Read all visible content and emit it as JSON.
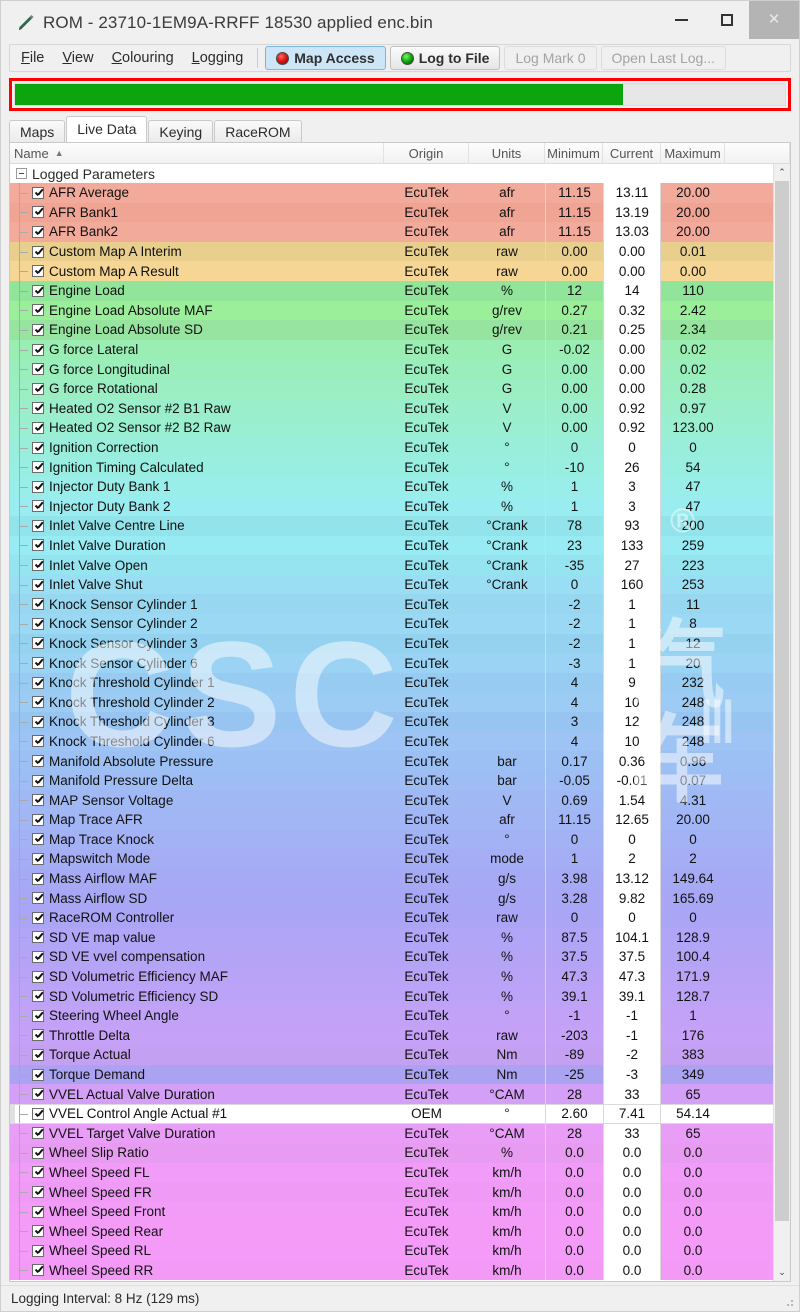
{
  "window": {
    "title": "ROM - 23710-1EM9A-RRFF 18530 applied enc.bin",
    "icon": "pen-icon",
    "minimize_label": "–",
    "maximize_label": "❐",
    "close_label": "×"
  },
  "menu": [
    {
      "label": "File",
      "accel": "F"
    },
    {
      "label": "View",
      "accel": "V"
    },
    {
      "label": "Colouring",
      "accel": "C"
    },
    {
      "label": "Logging",
      "accel": "L"
    }
  ],
  "toolbar": {
    "map_access": {
      "label": "Map Access",
      "icon": "red-led-icon",
      "state": "active",
      "led_color": "#e01515"
    },
    "log_to_file": {
      "label": "Log to File",
      "icon": "green-led-icon",
      "state": "enabled",
      "led_color": "#16b311"
    },
    "log_mark": {
      "label": "Log Mark 0",
      "state": "disabled"
    },
    "open_last_log": {
      "label": "Open Last Log...",
      "state": "disabled"
    }
  },
  "progress": {
    "percent": 79,
    "fill_color": "#0da50d",
    "border_color": "#fe0000"
  },
  "tabs": [
    {
      "label": "Maps",
      "selected": false
    },
    {
      "label": "Live Data",
      "selected": true
    },
    {
      "label": "Keying",
      "selected": false
    },
    {
      "label": "RaceROM",
      "selected": false
    }
  ],
  "grid": {
    "columns": [
      {
        "key": "name",
        "label": "Name",
        "sorted": "asc",
        "sort_glyph": "▲"
      },
      {
        "key": "origin",
        "label": "Origin"
      },
      {
        "key": "units",
        "label": "Units"
      },
      {
        "key": "minimum",
        "label": "Minimum"
      },
      {
        "key": "current",
        "label": "Current"
      },
      {
        "key": "maximum",
        "label": "Maximum"
      }
    ],
    "group_label": "Logged Parameters",
    "group_expanded": true,
    "scroll_up_glyph": "⌃",
    "scroll_down_glyph": "⌄",
    "rows": [
      {
        "checked": true,
        "name": "AFR Average",
        "origin": "EcuTek",
        "units": "afr",
        "minimum": "11.15",
        "current": "13.11",
        "maximum": "20.00",
        "bg": "#f2aa9b"
      },
      {
        "checked": true,
        "name": "AFR Bank1",
        "origin": "EcuTek",
        "units": "afr",
        "minimum": "11.15",
        "current": "13.19",
        "maximum": "20.00",
        "bg": "#efa494"
      },
      {
        "checked": true,
        "name": "AFR Bank2",
        "origin": "EcuTek",
        "units": "afr",
        "minimum": "11.15",
        "current": "13.03",
        "maximum": "20.00",
        "bg": "#f2aa9b"
      },
      {
        "checked": true,
        "name": "Custom Map A Interim",
        "origin": "EcuTek",
        "units": "raw",
        "minimum": "0.00",
        "current": "0.00",
        "maximum": "0.01",
        "bg": "#e8cf8e"
      },
      {
        "checked": true,
        "name": "Custom Map A Result",
        "origin": "EcuTek",
        "units": "raw",
        "minimum": "0.00",
        "current": "0.00",
        "maximum": "0.00",
        "bg": "#f6d694"
      },
      {
        "checked": true,
        "name": "Engine Load",
        "origin": "EcuTek",
        "units": "%",
        "minimum": "12",
        "current": "14",
        "maximum": "110",
        "bg": "#90e59a"
      },
      {
        "checked": true,
        "name": "Engine Load Absolute MAF",
        "origin": "EcuTek",
        "units": "g/rev",
        "minimum": "0.27",
        "current": "0.32",
        "maximum": "2.42",
        "bg": "#9bef9b"
      },
      {
        "checked": true,
        "name": "Engine Load Absolute SD",
        "origin": "EcuTek",
        "units": "g/rev",
        "minimum": "0.21",
        "current": "0.25",
        "maximum": "2.34",
        "bg": "#97e4a0"
      },
      {
        "checked": true,
        "name": "G force Lateral",
        "origin": "EcuTek",
        "units": "G",
        "minimum": "-0.02",
        "current": "0.00",
        "maximum": "0.02",
        "bg": "#9aeeb4"
      },
      {
        "checked": true,
        "name": "G force Longitudinal",
        "origin": "EcuTek",
        "units": "G",
        "minimum": "0.00",
        "current": "0.00",
        "maximum": "0.02",
        "bg": "#9aeebb"
      },
      {
        "checked": true,
        "name": "G force Rotational",
        "origin": "EcuTek",
        "units": "G",
        "minimum": "0.00",
        "current": "0.00",
        "maximum": "0.28",
        "bg": "#9aeec2"
      },
      {
        "checked": true,
        "name": "Heated O2 Sensor #2 B1 Raw",
        "origin": "EcuTek",
        "units": "V",
        "minimum": "0.00",
        "current": "0.92",
        "maximum": "0.97",
        "bg": "#9aeeca"
      },
      {
        "checked": true,
        "name": "Heated O2 Sensor #2 B2 Raw",
        "origin": "EcuTek",
        "units": "V",
        "minimum": "0.00",
        "current": "0.92",
        "maximum": "123.00",
        "bg": "#9aefd2"
      },
      {
        "checked": true,
        "name": "Ignition Correction",
        "origin": "EcuTek",
        "units": "°",
        "minimum": "0",
        "current": "0",
        "maximum": "0",
        "bg": "#99eedb"
      },
      {
        "checked": true,
        "name": "Ignition Timing Calculated",
        "origin": "EcuTek",
        "units": "°",
        "minimum": "-10",
        "current": "26",
        "maximum": "54",
        "bg": "#99eee2"
      },
      {
        "checked": true,
        "name": "Injector Duty Bank 1",
        "origin": "EcuTek",
        "units": "%",
        "minimum": "1",
        "current": "3",
        "maximum": "47",
        "bg": "#99eeea"
      },
      {
        "checked": true,
        "name": "Injector Duty Bank 2",
        "origin": "EcuTek",
        "units": "%",
        "minimum": "1",
        "current": "3",
        "maximum": "47",
        "bg": "#99ecef"
      },
      {
        "checked": true,
        "name": "Inlet Valve Centre Line",
        "origin": "EcuTek",
        "units": "°Crank",
        "minimum": "78",
        "current": "93",
        "maximum": "200",
        "bg": "#93e4ea"
      },
      {
        "checked": true,
        "name": "Inlet Valve Duration",
        "origin": "EcuTek",
        "units": "°Crank",
        "minimum": "23",
        "current": "133",
        "maximum": "259",
        "bg": "#99ebf3"
      },
      {
        "checked": true,
        "name": "Inlet Valve Open",
        "origin": "EcuTek",
        "units": "°Crank",
        "minimum": "-35",
        "current": "27",
        "maximum": "223",
        "bg": "#96e4ef"
      },
      {
        "checked": true,
        "name": "Inlet Valve Shut",
        "origin": "EcuTek",
        "units": "°Crank",
        "minimum": "0",
        "current": "160",
        "maximum": "253",
        "bg": "#9adef3"
      },
      {
        "checked": true,
        "name": "Knock Sensor Cylinder 1",
        "origin": "EcuTek",
        "units": "",
        "minimum": "-2",
        "current": "1",
        "maximum": "11",
        "bg": "#97d7f0"
      },
      {
        "checked": true,
        "name": "Knock Sensor Cylinder 2",
        "origin": "EcuTek",
        "units": "",
        "minimum": "-2",
        "current": "1",
        "maximum": "8",
        "bg": "#9ad8f3"
      },
      {
        "checked": true,
        "name": "Knock Sensor Cylinder 3",
        "origin": "EcuTek",
        "units": "",
        "minimum": "-2",
        "current": "1",
        "maximum": "12",
        "bg": "#95d2f0"
      },
      {
        "checked": true,
        "name": "Knock Sensor Cylinder 6",
        "origin": "EcuTek",
        "units": "",
        "minimum": "-3",
        "current": "1",
        "maximum": "20",
        "bg": "#9bd3f4"
      },
      {
        "checked": true,
        "name": "Knock Threshold Cylinder 1",
        "origin": "EcuTek",
        "units": "",
        "minimum": "4",
        "current": "9",
        "maximum": "232",
        "bg": "#97cbf1"
      },
      {
        "checked": true,
        "name": "Knock Threshold Cylinder 2",
        "origin": "EcuTek",
        "units": "",
        "minimum": "4",
        "current": "10",
        "maximum": "248",
        "bg": "#9ccbf4"
      },
      {
        "checked": true,
        "name": "Knock Threshold Cylinder 3",
        "origin": "EcuTek",
        "units": "",
        "minimum": "3",
        "current": "12",
        "maximum": "248",
        "bg": "#98c4f1"
      },
      {
        "checked": true,
        "name": "Knock Threshold Cylinder 6",
        "origin": "EcuTek",
        "units": "",
        "minimum": "4",
        "current": "10",
        "maximum": "248",
        "bg": "#9dc4f4"
      },
      {
        "checked": true,
        "name": "Manifold Absolute Pressure",
        "origin": "EcuTek",
        "units": "bar",
        "minimum": "0.17",
        "current": "0.36",
        "maximum": "0.96",
        "bg": "#9dc0f4"
      },
      {
        "checked": true,
        "name": "Manifold Pressure Delta",
        "origin": "EcuTek",
        "units": "bar",
        "minimum": "-0.05",
        "current": "-0.01",
        "maximum": "0.07",
        "bg": "#9fbdf5"
      },
      {
        "checked": true,
        "name": "MAP Sensor Voltage",
        "origin": "EcuTek",
        "units": "V",
        "minimum": "0.69",
        "current": "1.54",
        "maximum": "4.31",
        "bg": "#a0b9f5"
      },
      {
        "checked": true,
        "name": "Map Trace AFR",
        "origin": "EcuTek",
        "units": "afr",
        "minimum": "11.15",
        "current": "12.65",
        "maximum": "20.00",
        "bg": "#a2b5f5"
      },
      {
        "checked": true,
        "name": "Map Trace Knock",
        "origin": "EcuTek",
        "units": "°",
        "minimum": "0",
        "current": "0",
        "maximum": "0",
        "bg": "#a3b1f5"
      },
      {
        "checked": true,
        "name": "Mapswitch Mode",
        "origin": "EcuTek",
        "units": "mode",
        "minimum": "1",
        "current": "2",
        "maximum": "2",
        "bg": "#a5aef5"
      },
      {
        "checked": true,
        "name": "Mass Airflow MAF",
        "origin": "EcuTek",
        "units": "g/s",
        "minimum": "3.98",
        "current": "13.12",
        "maximum": "149.64",
        "bg": "#a6aaf5"
      },
      {
        "checked": true,
        "name": "Mass Airflow SD",
        "origin": "EcuTek",
        "units": "g/s",
        "minimum": "3.28",
        "current": "9.82",
        "maximum": "165.69",
        "bg": "#a8a7f6"
      },
      {
        "checked": true,
        "name": "RaceROM Controller",
        "origin": "EcuTek",
        "units": "raw",
        "minimum": "0",
        "current": "0",
        "maximum": "0",
        "bg": "#aba5f6"
      },
      {
        "checked": true,
        "name": "SD VE map value",
        "origin": "EcuTek",
        "units": "%",
        "minimum": "87.5",
        "current": "104.1",
        "maximum": "128.9",
        "bg": "#b0a5f6"
      },
      {
        "checked": true,
        "name": "SD VE vvel compensation",
        "origin": "EcuTek",
        "units": "%",
        "minimum": "37.5",
        "current": "37.5",
        "maximum": "100.4",
        "bg": "#b4a4f6"
      },
      {
        "checked": true,
        "name": "SD Volumetric Efficiency MAF",
        "origin": "EcuTek",
        "units": "%",
        "minimum": "47.3",
        "current": "47.3",
        "maximum": "171.9",
        "bg": "#b8a3f6"
      },
      {
        "checked": true,
        "name": "SD Volumetric Efficiency SD",
        "origin": "EcuTek",
        "units": "%",
        "minimum": "39.1",
        "current": "39.1",
        "maximum": "128.7",
        "bg": "#bda3f7"
      },
      {
        "checked": true,
        "name": "Steering Wheel Angle",
        "origin": "EcuTek",
        "units": "°",
        "minimum": "-1",
        "current": "-1",
        "maximum": "1",
        "bg": "#c1a2f7"
      },
      {
        "checked": true,
        "name": "Throttle Delta",
        "origin": "EcuTek",
        "units": "raw",
        "minimum": "-203",
        "current": "-1",
        "maximum": "176",
        "bg": "#c5a1f7"
      },
      {
        "checked": true,
        "name": "Torque Actual",
        "origin": "EcuTek",
        "units": "Nm",
        "minimum": "-89",
        "current": "-2",
        "maximum": "383",
        "bg": "#c4a0f3"
      },
      {
        "checked": true,
        "name": "Torque Demand",
        "origin": "EcuTek",
        "units": "Nm",
        "minimum": "-25",
        "current": "-3",
        "maximum": "349",
        "bg": "#aba3f2"
      },
      {
        "checked": true,
        "name": "VVEL Actual Valve Duration",
        "origin": "EcuTek",
        "units": "°CAM",
        "minimum": "28",
        "current": "33",
        "maximum": "65",
        "bg": "#d49ff7"
      },
      {
        "checked": true,
        "name": "VVEL Control Angle Actual #1",
        "origin": "OEM",
        "units": "°",
        "minimum": "2.60",
        "current": "7.41",
        "maximum": "54.14",
        "bg": "#ffffff",
        "selected": true
      },
      {
        "checked": true,
        "name": "VVEL Target Valve Duration",
        "origin": "EcuTek",
        "units": "°CAM",
        "minimum": "28",
        "current": "33",
        "maximum": "65",
        "bg": "#e89df7"
      },
      {
        "checked": true,
        "name": "Wheel Slip Ratio",
        "origin": "EcuTek",
        "units": "%",
        "minimum": "0.0",
        "current": "0.0",
        "maximum": "0.0",
        "bg": "#e79bf1"
      },
      {
        "checked": true,
        "name": "Wheel Speed FL",
        "origin": "EcuTek",
        "units": "km/h",
        "minimum": "0.0",
        "current": "0.0",
        "maximum": "0.0",
        "bg": "#f09cf8"
      },
      {
        "checked": true,
        "name": "Wheel Speed FR",
        "origin": "EcuTek",
        "units": "km/h",
        "minimum": "0.0",
        "current": "0.0",
        "maximum": "0.0",
        "bg": "#ef9bf6"
      },
      {
        "checked": true,
        "name": "Wheel Speed Front",
        "origin": "EcuTek",
        "units": "km/h",
        "minimum": "0.0",
        "current": "0.0",
        "maximum": "0.0",
        "bg": "#f29cf8"
      },
      {
        "checked": true,
        "name": "Wheel Speed Rear",
        "origin": "EcuTek",
        "units": "km/h",
        "minimum": "0.0",
        "current": "0.0",
        "maximum": "0.0",
        "bg": "#f39bf7"
      },
      {
        "checked": true,
        "name": "Wheel Speed RL",
        "origin": "EcuTek",
        "units": "km/h",
        "minimum": "0.0",
        "current": "0.0",
        "maximum": "0.0",
        "bg": "#f49af8"
      },
      {
        "checked": true,
        "name": "Wheel Speed RR",
        "origin": "EcuTek",
        "units": "km/h",
        "minimum": "0.0",
        "current": "0.0",
        "maximum": "0.0",
        "bg": "#f39af7"
      }
    ]
  },
  "statusbar": {
    "text": "Logging Interval: 8 Hz (129 ms)"
  },
  "watermark": {
    "primary": "CSC",
    "secondary": "汽车",
    "tertiary": "®"
  }
}
